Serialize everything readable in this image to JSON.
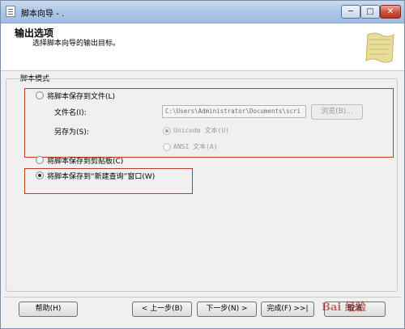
{
  "window": {
    "title": "脚本向导 - .",
    "minimize": "─",
    "maximize": "□",
    "close": "✕"
  },
  "header": {
    "title": "输出选项",
    "subtitle": "选择脚本向导的输出目标。",
    "icon": "scroll-icon"
  },
  "group": {
    "label": "脚本模式",
    "options": {
      "save_to_file": "将脚本保存到文件(L)",
      "file_name_label": "文件名(I):",
      "file_name_value": "C:\\Users\\Administrator\\Documents\\scri",
      "browse": "浏览(B)...",
      "save_as_label": "另存为(S):",
      "unicode_option": "Unicode 文本(U)",
      "ansi_option": "ANSI 文本(A)",
      "clipboard": "将脚本保存到剪贴板(C)",
      "new_query": "将脚本保存到“新建查询”窗口(W)"
    },
    "selected": "new_query"
  },
  "footer": {
    "help": "帮助(H)",
    "prev": "< 上一步(B)",
    "next": "下一步(N) >",
    "finish": "完成(F) >>|",
    "cancel": "取消"
  },
  "watermark": "Bai 经验",
  "colors": {
    "highlight_box": "#c0392b",
    "titlebar": "#aac5e6",
    "close": "#c9503b"
  }
}
